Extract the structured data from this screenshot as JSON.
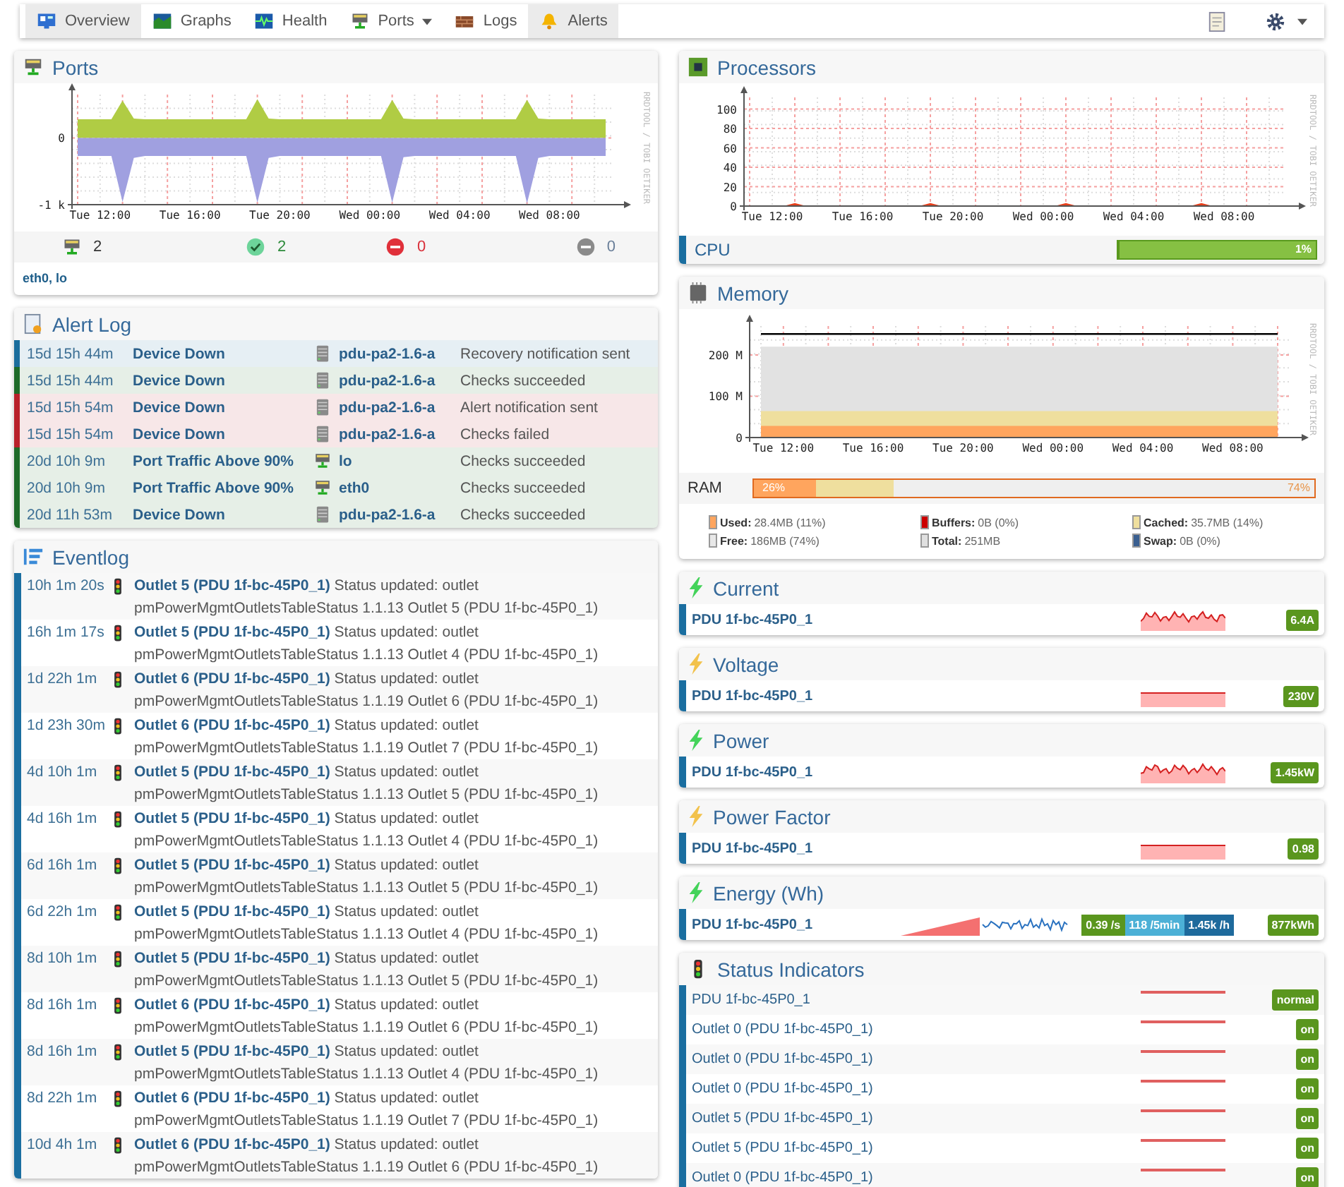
{
  "nav": {
    "tabs": [
      {
        "label": "Overview",
        "kind": "overview",
        "selected": true,
        "dropdown": false
      },
      {
        "label": "Graphs",
        "kind": "graphs",
        "selected": false,
        "dropdown": false
      },
      {
        "label": "Health",
        "kind": "health",
        "selected": false,
        "dropdown": false
      },
      {
        "label": "Ports",
        "kind": "ports",
        "selected": false,
        "dropdown": true
      },
      {
        "label": "Logs",
        "kind": "logs",
        "selected": false,
        "dropdown": false
      },
      {
        "label": "Alerts",
        "kind": "alerts",
        "selected": true,
        "dropdown": false
      }
    ],
    "tools": [
      {
        "kind": "notes",
        "dropdown": false
      },
      {
        "kind": "settings",
        "dropdown": true
      }
    ]
  },
  "ports": {
    "title": "Ports",
    "credit": "RRDTOOL / TOBI OETIKER",
    "chart_data": {
      "type": "area",
      "grid": true,
      "categories": [
        null,
        null,
        "Tue 12:00",
        null,
        null,
        null,
        null,
        null,
        null,
        null,
        "Tue 16:00",
        null,
        null,
        null,
        null,
        null,
        null,
        null,
        "Tue 20:00",
        null,
        null,
        null,
        null,
        null,
        null,
        null,
        "Wed 00:00",
        null,
        null,
        null,
        null,
        null,
        null,
        null,
        "Wed 04:00",
        null,
        null,
        null,
        null,
        null,
        null,
        null,
        "Wed 08:00",
        null,
        null,
        null,
        null,
        null
      ],
      "series": [
        {
          "color": "#b0cc44",
          "values": [
            280,
            280,
            280,
            280,
            560,
            290,
            280,
            280,
            280,
            280,
            280,
            280,
            280,
            280,
            280,
            280,
            580,
            290,
            280,
            280,
            280,
            280,
            280,
            280,
            280,
            280,
            280,
            280,
            570,
            290,
            280,
            280,
            280,
            280,
            280,
            280,
            280,
            280,
            280,
            280,
            570,
            290,
            280,
            280,
            280,
            280,
            280,
            280
          ]
        },
        {
          "color": "#a0a0e0",
          "values": [
            -270,
            -270,
            -270,
            -270,
            -960,
            -300,
            -270,
            -270,
            -270,
            -270,
            -270,
            -270,
            -270,
            -270,
            -270,
            -270,
            -970,
            -300,
            -270,
            -270,
            -270,
            -270,
            -270,
            -270,
            -270,
            -270,
            -270,
            -270,
            -970,
            -290,
            -270,
            -270,
            -270,
            -270,
            -270,
            -270,
            -270,
            -270,
            -270,
            -270,
            -980,
            -300,
            -270,
            -270,
            -270,
            -270,
            -270,
            -270
          ]
        }
      ],
      "ylim": [
        -1000,
        650
      ],
      "yticks": [
        {
          "value": 0,
          "label": "0"
        },
        {
          "value": -1000,
          "label": "-1 k"
        }
      ]
    },
    "counts": [
      {
        "kind": "total",
        "value": "2"
      },
      {
        "kind": "up",
        "value": "2"
      },
      {
        "kind": "down",
        "value": "0"
      },
      {
        "kind": "disabled",
        "value": "0"
      }
    ],
    "port_list": "eth0, lo"
  },
  "alert_log": {
    "title": "Alert Log",
    "rows": [
      {
        "color": "#1b6d9c",
        "time": "15d 15h 44m",
        "rule": "Device Down",
        "kind": "device",
        "target": "pdu-pa2-1.6-a",
        "message": "Recovery notification sent"
      },
      {
        "color": "#1d6a28",
        "time": "15d 15h 44m",
        "rule": "Device Down",
        "kind": "device",
        "target": "pdu-pa2-1.6-a",
        "message": "Checks succeeded"
      },
      {
        "color": "#b8202a",
        "time": "15d 15h 54m",
        "rule": "Device Down",
        "kind": "device",
        "target": "pdu-pa2-1.6-a",
        "message": "Alert notification sent"
      },
      {
        "color": "#b8202a",
        "time": "15d 15h 54m",
        "rule": "Device Down",
        "kind": "device",
        "target": "pdu-pa2-1.6-a",
        "message": "Checks failed"
      },
      {
        "color": "#1d6a28",
        "time": "20d 10h 9m",
        "rule": "Port Traffic Above 90%",
        "kind": "port",
        "target": "lo",
        "message": "Checks succeeded"
      },
      {
        "color": "#1d6a28",
        "time": "20d 10h 9m",
        "rule": "Port Traffic Above 90%",
        "kind": "port",
        "target": "eth0",
        "message": "Checks succeeded"
      },
      {
        "color": "#1d6a28",
        "time": "20d 11h 53m",
        "rule": "Device Down",
        "kind": "device",
        "target": "pdu-pa2-1.6-a",
        "message": "Checks succeeded"
      }
    ]
  },
  "eventlog": {
    "title": "Eventlog",
    "rows": [
      {
        "time": "10h 1m 20s",
        "entity": "Outlet 5 (PDU 1f-bc-45P0_1)",
        "message": "Status updated: outlet pmPowerMgmtOutletsTableStatus 1.1.13 Outlet 5 (PDU 1f-bc-45P0_1)"
      },
      {
        "time": "16h 1m 17s",
        "entity": "Outlet 5 (PDU 1f-bc-45P0_1)",
        "message": "Status updated: outlet pmPowerMgmtOutletsTableStatus 1.1.13 Outlet 4 (PDU 1f-bc-45P0_1)"
      },
      {
        "time": "1d 22h 1m",
        "entity": "Outlet 6 (PDU 1f-bc-45P0_1)",
        "message": "Status updated: outlet pmPowerMgmtOutletsTableStatus 1.1.19 Outlet 6 (PDU 1f-bc-45P0_1)"
      },
      {
        "time": "1d 23h 30m",
        "entity": "Outlet 6 (PDU 1f-bc-45P0_1)",
        "message": "Status updated: outlet pmPowerMgmtOutletsTableStatus 1.1.19 Outlet 7 (PDU 1f-bc-45P0_1)"
      },
      {
        "time": "4d 10h 1m",
        "entity": "Outlet 5 (PDU 1f-bc-45P0_1)",
        "message": "Status updated: outlet pmPowerMgmtOutletsTableStatus 1.1.13 Outlet 5 (PDU 1f-bc-45P0_1)"
      },
      {
        "time": "4d 16h 1m",
        "entity": "Outlet 5 (PDU 1f-bc-45P0_1)",
        "message": "Status updated: outlet pmPowerMgmtOutletsTableStatus 1.1.13 Outlet 4 (PDU 1f-bc-45P0_1)"
      },
      {
        "time": "6d 16h 1m",
        "entity": "Outlet 5 (PDU 1f-bc-45P0_1)",
        "message": "Status updated: outlet pmPowerMgmtOutletsTableStatus 1.1.13 Outlet 5 (PDU 1f-bc-45P0_1)"
      },
      {
        "time": "6d 22h 1m",
        "entity": "Outlet 5 (PDU 1f-bc-45P0_1)",
        "message": "Status updated: outlet pmPowerMgmtOutletsTableStatus 1.1.13 Outlet 4 (PDU 1f-bc-45P0_1)"
      },
      {
        "time": "8d 10h 1m",
        "entity": "Outlet 5 (PDU 1f-bc-45P0_1)",
        "message": "Status updated: outlet pmPowerMgmtOutletsTableStatus 1.1.13 Outlet 5 (PDU 1f-bc-45P0_1)"
      },
      {
        "time": "8d 16h 1m",
        "entity": "Outlet 6 (PDU 1f-bc-45P0_1)",
        "message": "Status updated: outlet pmPowerMgmtOutletsTableStatus 1.1.19 Outlet 6 (PDU 1f-bc-45P0_1)"
      },
      {
        "time": "8d 16h 1m",
        "entity": "Outlet 5 (PDU 1f-bc-45P0_1)",
        "message": "Status updated: outlet pmPowerMgmtOutletsTableStatus 1.1.13 Outlet 4 (PDU 1f-bc-45P0_1)"
      },
      {
        "time": "8d 22h 1m",
        "entity": "Outlet 6 (PDU 1f-bc-45P0_1)",
        "message": "Status updated: outlet pmPowerMgmtOutletsTableStatus 1.1.19 Outlet 7 (PDU 1f-bc-45P0_1)"
      },
      {
        "time": "10d 4h 1m",
        "entity": "Outlet 6 (PDU 1f-bc-45P0_1)",
        "message": "Status updated: outlet pmPowerMgmtOutletsTableStatus 1.1.19 Outlet 6 (PDU 1f-bc-45P0_1)"
      }
    ]
  },
  "processors": {
    "title": "Processors",
    "credit": "RRDTOOL / TOBI OETIKER",
    "chart_data": {
      "type": "area",
      "grid": true,
      "categories": [
        null,
        null,
        "Tue 12:00",
        null,
        null,
        null,
        null,
        null,
        null,
        null,
        "Tue 16:00",
        null,
        null,
        null,
        null,
        null,
        null,
        null,
        "Tue 20:00",
        null,
        null,
        null,
        null,
        null,
        null,
        null,
        "Wed 00:00",
        null,
        null,
        null,
        null,
        null,
        null,
        null,
        "Wed 04:00",
        null,
        null,
        null,
        null,
        null,
        null,
        null,
        "Wed 08:00",
        null,
        null,
        null,
        null,
        null
      ],
      "series": [
        {
          "color": "#e8401c",
          "values": [
            0,
            0,
            0,
            0,
            3,
            0,
            0,
            0,
            0,
            0,
            0,
            0,
            0,
            0,
            0,
            0,
            3,
            0,
            0,
            0,
            0,
            0,
            0,
            0,
            0,
            0,
            0,
            0,
            3,
            0,
            0,
            0,
            0,
            0,
            0,
            0,
            0,
            0,
            0,
            0,
            3,
            0,
            0,
            0,
            0,
            0,
            0,
            0
          ]
        }
      ],
      "ylim": [
        0,
        112
      ],
      "yticks": [
        0,
        20,
        40,
        60,
        80,
        100
      ]
    },
    "rows": [
      {
        "name": "CPU",
        "level": 0.01,
        "reading": "1%"
      }
    ]
  },
  "memory": {
    "title": "Memory",
    "credit": "RRDTOOL / TOBI OETIKER",
    "chart_data": {
      "type": "area",
      "grid": true,
      "categories": [
        null,
        "Tue 12:00",
        null,
        null,
        null,
        "Tue 16:00",
        null,
        null,
        null,
        "Tue 20:00",
        null,
        null,
        null,
        "Wed 00:00",
        null,
        null,
        null,
        "Wed 04:00",
        null,
        null,
        null,
        "Wed 08:00",
        null,
        null
      ],
      "series": [
        {
          "color": "#e2e2e2",
          "values": [
            220,
            220,
            220,
            220,
            220,
            220,
            220,
            220,
            220,
            220,
            220,
            220,
            220,
            220,
            220,
            220,
            220,
            220,
            220,
            220,
            220,
            220,
            220,
            220
          ]
        },
        {
          "color": "#efdf9e",
          "values": [
            64,
            64,
            64,
            64,
            64,
            64,
            64,
            64,
            64,
            64,
            64,
            64,
            64,
            64,
            64,
            64,
            64,
            64,
            64,
            64,
            64,
            64,
            64,
            64
          ]
        },
        {
          "color": "#ffa55e",
          "values": [
            28,
            28,
            28,
            28,
            28,
            28,
            28,
            28,
            28,
            28,
            28,
            28,
            28,
            28,
            28,
            28,
            28,
            28,
            28,
            28,
            28,
            28,
            28,
            28
          ]
        },
        {
          "type": "line",
          "color": "#000000",
          "values": [
            251,
            251,
            251,
            251,
            251,
            251,
            251,
            251,
            251,
            251,
            251,
            251,
            251,
            251,
            251,
            251,
            251,
            251,
            251,
            251,
            251,
            251,
            251,
            251
          ]
        }
      ],
      "ylim": [
        0,
        270
      ],
      "yticks": [
        {
          "value": 0,
          "label": "0"
        },
        {
          "value": 100,
          "label": "100 M"
        },
        {
          "value": 200,
          "label": "200 M"
        }
      ]
    },
    "ram": {
      "label": "RAM",
      "used_label": "26%",
      "free_label": "74%",
      "segments": [
        {
          "color": "#ffa55e",
          "level": 0.11
        },
        {
          "color": "#efdf9e",
          "level": 0.14
        }
      ]
    },
    "legend": [
      {
        "label": "Used:",
        "value": "28.4MB (11%)",
        "color": "#ffa55e"
      },
      {
        "label": "Buffers:",
        "value": "0B (0%)",
        "color": "#cc0000"
      },
      {
        "label": "Cached:",
        "value": "35.7MB (14%)",
        "color": "#efdf9e"
      },
      {
        "label": "Free:",
        "value": "186MB (74%)",
        "color": "#e8e8e8"
      },
      {
        "label": "Total:",
        "value": "251MB",
        "color": "#e0e0e0"
      },
      {
        "label": "Swap:",
        "value": "0B (0%)",
        "color": "#3a5f90"
      }
    ]
  },
  "sensors": [
    {
      "title": "Current",
      "color": "#44d35a",
      "rows": [
        {
          "kind": "varying",
          "name": "PDU 1f-bc-45P0_1",
          "value": "6.4A"
        }
      ]
    },
    {
      "title": "Voltage",
      "color": "#f2c24c",
      "rows": [
        {
          "kind": "steady",
          "name": "PDU 1f-bc-45P0_1",
          "value": "230V"
        }
      ]
    },
    {
      "title": "Power",
      "color": "#44d35a",
      "rows": [
        {
          "kind": "varying",
          "name": "PDU 1f-bc-45P0_1",
          "value": "1.45kW"
        }
      ]
    },
    {
      "title": "Power Factor",
      "color": "#f2c24c",
      "rows": [
        {
          "kind": "steady",
          "name": "PDU 1f-bc-45P0_1",
          "value": "0.98"
        }
      ]
    },
    {
      "title": "Energy (Wh)",
      "color": "#44d35a",
      "rows": [
        {
          "kind": "counter",
          "name": "PDU 1f-bc-45P0_1",
          "rates": [
            {
              "label": "0.39 /s",
              "color": "#5a961e"
            },
            {
              "label": "118 /5min",
              "color": "#4cb0d6"
            },
            {
              "label": "1.45k /h",
              "color": "#1e6a9c"
            }
          ],
          "value": "877kWh"
        }
      ]
    }
  ],
  "status_indicators": {
    "title": "Status Indicators",
    "rows": [
      {
        "name": "PDU 1f-bc-45P0_1",
        "value": "normal"
      },
      {
        "name": "Outlet 0 (PDU 1f-bc-45P0_1)",
        "value": "on"
      },
      {
        "name": "Outlet 0 (PDU 1f-bc-45P0_1)",
        "value": "on"
      },
      {
        "name": "Outlet 0 (PDU 1f-bc-45P0_1)",
        "value": "on"
      },
      {
        "name": "Outlet 5 (PDU 1f-bc-45P0_1)",
        "value": "on"
      },
      {
        "name": "Outlet 5 (PDU 1f-bc-45P0_1)",
        "value": "on"
      },
      {
        "name": "Outlet 0 (PDU 1f-bc-45P0_1)",
        "value": "on"
      }
    ]
  }
}
